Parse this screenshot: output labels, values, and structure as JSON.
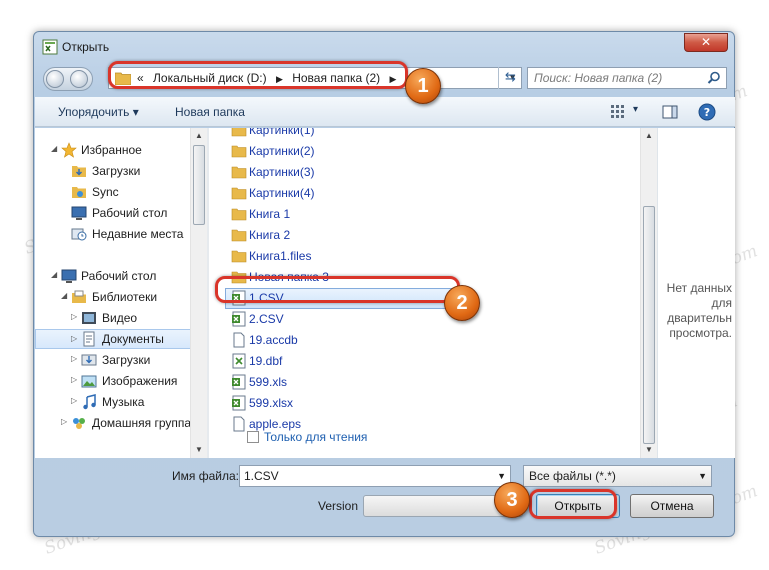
{
  "window": {
    "title": "Открыть",
    "close_label": "✕"
  },
  "address": {
    "prefix": "«",
    "crumbs": [
      "Локальный диск (D:)",
      "Новая папка (2)"
    ],
    "search_placeholder": "Поиск: Новая папка (2)"
  },
  "toolbar": {
    "organize_label": "Упорядочить ▾",
    "new_folder_label": "Новая папка",
    "view_dropdown": "▾"
  },
  "sidebar": {
    "items": [
      {
        "label": "Избранное",
        "icon": "star-icon"
      },
      {
        "label": "Загрузки",
        "icon": "downloads-folder-icon"
      },
      {
        "label": "Sync",
        "icon": "sync-folder-icon"
      },
      {
        "label": "Рабочий стол",
        "icon": "desktop-icon"
      },
      {
        "label": "Недавние места",
        "icon": "recent-places-icon"
      },
      {
        "label": "Рабочий стол",
        "icon": "desktop-icon"
      },
      {
        "label": "Библиотеки",
        "icon": "libraries-icon"
      },
      {
        "label": "Видео",
        "icon": "video-library-icon"
      },
      {
        "label": "Документы",
        "icon": "documents-library-icon"
      },
      {
        "label": "Загрузки",
        "icon": "downloads-library-icon"
      },
      {
        "label": "Изображения",
        "icon": "pictures-library-icon"
      },
      {
        "label": "Музыка",
        "icon": "music-library-icon"
      },
      {
        "label": "Домашняя группа",
        "icon": "homegroup-icon"
      }
    ]
  },
  "files": {
    "items": [
      {
        "name": "Картинки(1)",
        "icon": "folder-icon"
      },
      {
        "name": "Картинки(2)",
        "icon": "folder-icon"
      },
      {
        "name": "Картинки(3)",
        "icon": "folder-icon"
      },
      {
        "name": "Картинки(4)",
        "icon": "folder-icon"
      },
      {
        "name": "Книга 1",
        "icon": "folder-icon"
      },
      {
        "name": "Книга 2",
        "icon": "folder-icon"
      },
      {
        "name": "Книга1.files",
        "icon": "folder-icon"
      },
      {
        "name": "Новая папка 3",
        "icon": "folder-icon"
      },
      {
        "name": "1.CSV",
        "icon": "excel-csv-file-icon"
      },
      {
        "name": "2.CSV",
        "icon": "excel-csv-file-icon"
      },
      {
        "name": "19.accdb",
        "icon": "file-icon"
      },
      {
        "name": "19.dbf",
        "icon": "excel-file-icon"
      },
      {
        "name": "599.xls",
        "icon": "excel-file-icon"
      },
      {
        "name": "599.xlsx",
        "icon": "excel-file-icon"
      },
      {
        "name": "apple.eps",
        "icon": "file-icon"
      }
    ]
  },
  "preview": {
    "line1": "Нет данных",
    "line2": "для",
    "line3": "дварительн",
    "line4": "просмотра."
  },
  "options": {
    "readonly_label": "Только для чтения"
  },
  "bottom": {
    "filename_label": "Имя файла:",
    "filename_value": "1.CSV",
    "filetype_value": "Все файлы (*.*)",
    "version_label": "Version",
    "open_label": "Открыть",
    "cancel_label": "Отмена"
  },
  "annotations": {
    "badge1": "1",
    "badge2": "2",
    "badge3": "3"
  },
  "watermark": "Sovinguerepair.com",
  "colors": {
    "highlight_border": "#d9352a",
    "badge_orange": "#e06914",
    "selection_blue": "#cde4fc",
    "link_blue": "#1a3aa8"
  }
}
